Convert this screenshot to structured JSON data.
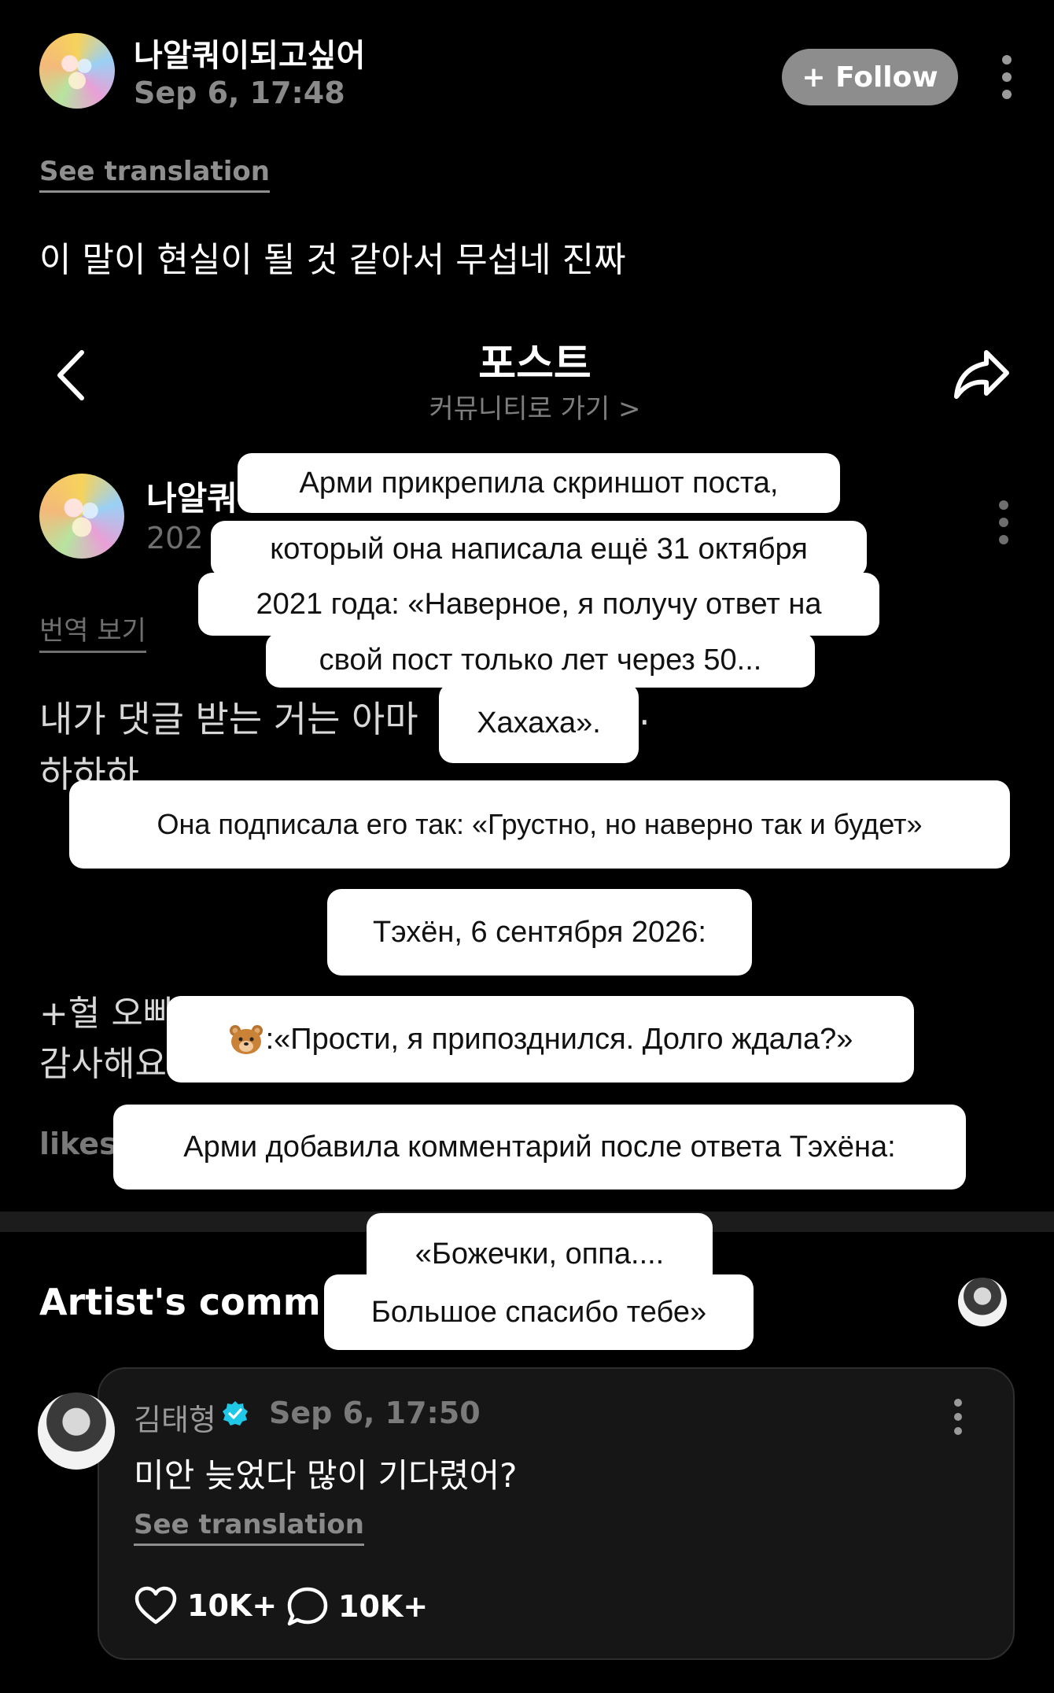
{
  "post": {
    "author": "나알쿼이되고싶어",
    "timestamp": "Sep 6, 17:48",
    "follow_label": "+ Follow",
    "see_translation": "See translation",
    "text": "이 말이 현실이 될 것 같아서 무섭네 진짜"
  },
  "embedded": {
    "nav_title": "포스트",
    "nav_subtitle": "커뮤니티로 가기 >",
    "author_partial": "나알쿼",
    "year_partial": "202",
    "translate_label": "번역 보기",
    "text_line1": "내가 댓글 받는 거는 아마",
    "text_line1_tail": ".",
    "text_line2": "하하하",
    "edit_line1": "+헐 오빠",
    "edit_line2": "감사해요",
    "likes_partial": "likes"
  },
  "artist_comments": {
    "title_partial": "Artist's comm",
    "comment": {
      "author": "김태형",
      "timestamp": "Sep 6, 17:50",
      "text": "미안 늦었다 많이 기다렸어?",
      "see_translation": "See translation",
      "likes": "10K+",
      "replies": "10K+"
    }
  },
  "captions": {
    "c1_line1": "Арми прикрепила скриншот поста,",
    "c1_line2": "который она написала ещё 31 октября",
    "c1_line3": "2021 года: «Наверное, я получу ответ на",
    "c1_line4": "свой пост только лет через 50...",
    "c1_line5": "Хахаха».",
    "c2": "Она подписала его так: «Грустно, но наверно так и будет»",
    "c3": "Тэхён, 6 сентября 2026:",
    "c4": ":«Прости, я припозднился. Долго ждала?»",
    "c5": "Арми добавила комментарий после ответа Тэхёна:",
    "c6_line1": "«Божечки, оппа....",
    "c6_line2": "Большое спасибо тебе»"
  },
  "icons": {
    "back": "chevron-left-icon",
    "share": "share-icon",
    "verified": "verified-badge-icon",
    "like": "heart-icon",
    "reply": "comment-bubble-icon",
    "emoji": "bear-emoji-icon"
  },
  "colors": {
    "background": "#000000",
    "follow_button": "#8d8d8d",
    "verified": "#1fc8e6",
    "caption_bg": "#ffffff"
  }
}
